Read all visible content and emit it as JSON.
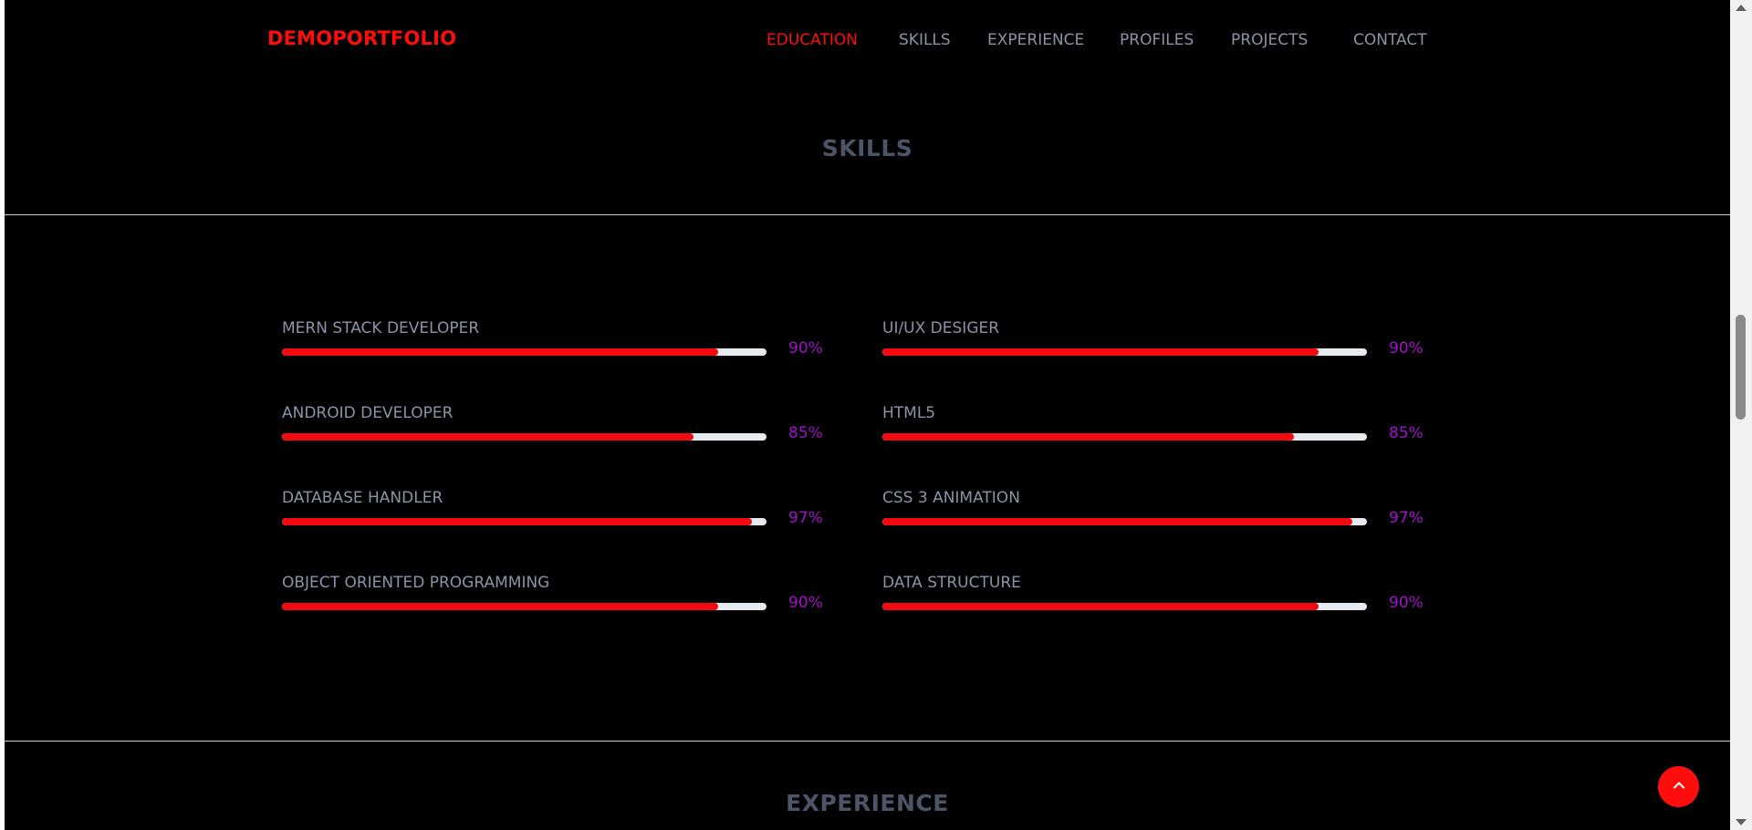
{
  "navbar": {
    "brand": "DEMOPORTFOLIO",
    "items": [
      {
        "label": "EDUCATION",
        "active": true
      },
      {
        "label": "SKILLS",
        "active": false
      },
      {
        "label": "EXPERIENCE",
        "active": false
      },
      {
        "label": "PROFILES",
        "active": false
      },
      {
        "label": "PROJECTS",
        "active": false
      },
      {
        "label": "CONTACT",
        "active": false
      }
    ]
  },
  "skills_section": {
    "title": "SKILLS",
    "left_column": [
      {
        "name": "MERN STACK DEVELOPER",
        "percent_label": "90%",
        "level": 0.9
      },
      {
        "name": "ANDROID DEVELOPER",
        "percent_label": "85%",
        "level": 0.85
      },
      {
        "name": "DATABASE HANDLER",
        "percent_label": "97%",
        "level": 0.97
      },
      {
        "name": "OBJECT ORIENTED PROGRAMMING",
        "percent_label": "90%",
        "level": 0.9
      }
    ],
    "right_column": [
      {
        "name": "UI/UX DESIGER",
        "percent_label": "90%",
        "level": 0.9
      },
      {
        "name": "HTML5",
        "percent_label": "85%",
        "level": 0.85
      },
      {
        "name": "CSS 3 ANIMATION",
        "percent_label": "97%",
        "level": 0.97
      },
      {
        "name": "DATA STRUCTURE",
        "percent_label": "90%",
        "level": 0.9
      }
    ]
  },
  "experience_section": {
    "title": "EXPERIENCE"
  },
  "colors": {
    "accent": "#ff0d0d",
    "percent_text": "#a012c8",
    "muted_text": "#8b93a7",
    "background": "#000000"
  },
  "icons": {
    "scroll_top": "chevron-up-icon"
  }
}
